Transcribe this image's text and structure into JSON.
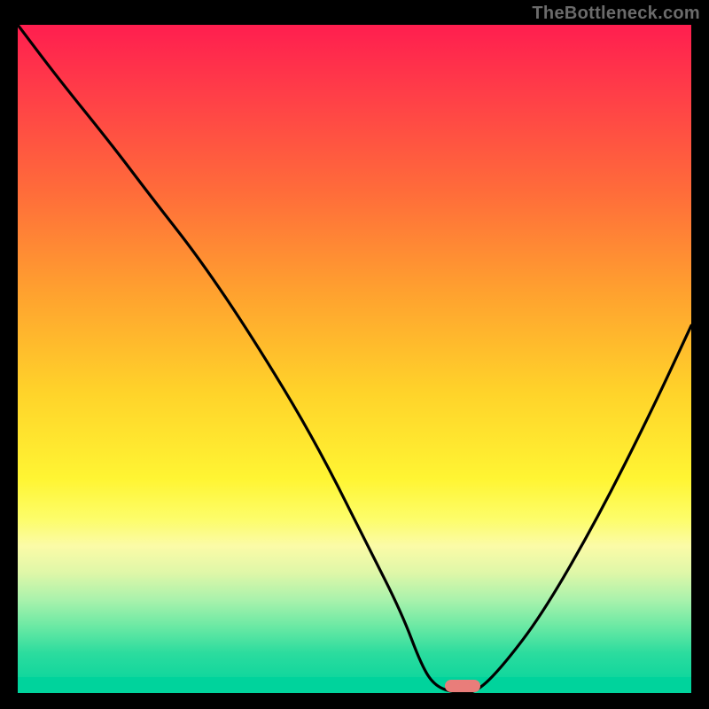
{
  "watermark": "TheBottleneck.com",
  "colors": {
    "page_bg": "#000000",
    "curve_stroke": "#000000",
    "marker_fill": "#e97d7a",
    "watermark_color": "#6b6b6b",
    "gradient_top": "#ff1e4f",
    "gradient_bottom": "#00d39c"
  },
  "chart_data": {
    "type": "line",
    "title": "",
    "xlabel": "",
    "ylabel": "",
    "xlim": [
      0,
      100
    ],
    "ylim": [
      0,
      100
    ],
    "legend": false,
    "grid": false,
    "background": "vertical red→green gradient (bottleneck heatmap)",
    "series": [
      {
        "name": "bottleneck-curve",
        "x": [
          0,
          6,
          14,
          20,
          27,
          35,
          44,
          52,
          57,
          60,
          62,
          65,
          68,
          72,
          78,
          86,
          94,
          100
        ],
        "values": [
          100,
          92,
          82,
          74,
          65,
          53,
          38,
          22,
          12,
          4,
          1,
          0,
          0,
          4,
          12,
          26,
          42,
          55
        ]
      }
    ],
    "annotations": [
      {
        "name": "optimal-marker",
        "shape": "pill",
        "x": 66,
        "y": 0,
        "color": "#e97d7a"
      }
    ]
  }
}
